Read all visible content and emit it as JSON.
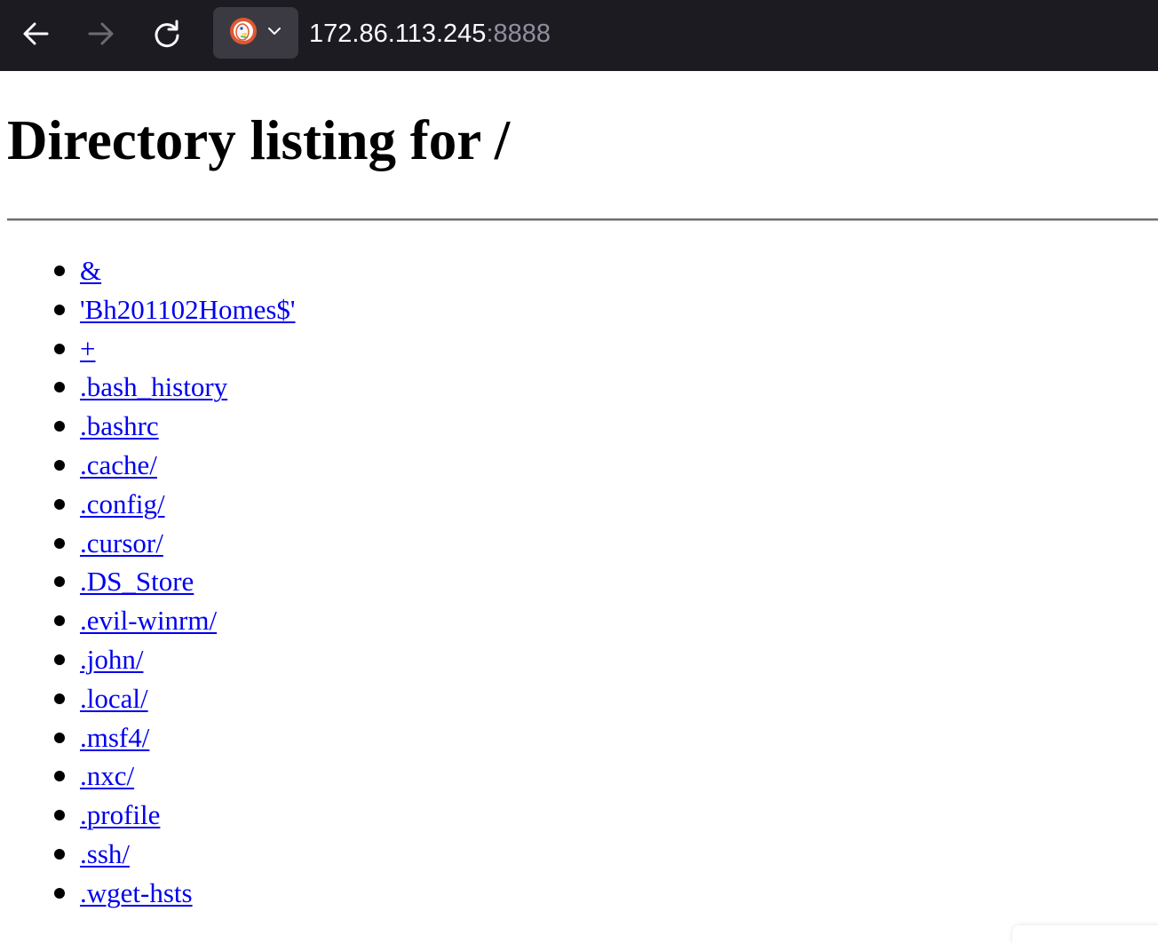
{
  "browser": {
    "icons": {
      "back": "arrow-left-icon",
      "forward": "arrow-right-icon",
      "reload": "reload-icon",
      "site": "duckduckgo-icon",
      "dropdown": "chevron-down-icon"
    },
    "url": {
      "host": "172.86.113.245",
      "port": ":8888"
    },
    "colors": {
      "toolbar_bg": "#1c1b22",
      "identity_bg": "#3b3a42",
      "link": "#0000ee"
    }
  },
  "page": {
    "title": "Directory listing for /",
    "entries": [
      "&",
      "'Bh201102Homes$'",
      "+",
      ".bash_history",
      ".bashrc",
      ".cache/",
      ".config/",
      ".cursor/",
      ".DS_Store",
      ".evil-winrm/",
      ".john/",
      ".local/",
      ".msf4/",
      ".nxc/",
      ".profile",
      ".ssh/",
      ".wget-hsts"
    ]
  }
}
